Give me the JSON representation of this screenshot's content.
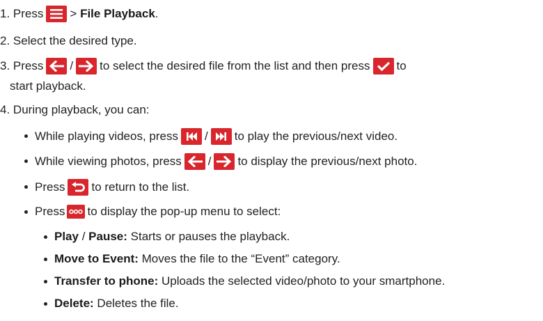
{
  "step1": {
    "num": "1.",
    "press": "Press",
    "sep": ">",
    "item": "File Playback",
    "end": "."
  },
  "step2": {
    "num": "2.",
    "text": "Select the desired type."
  },
  "step3": {
    "num": "3.",
    "press": "Press",
    "slash": "/",
    "mid": "to select the desired file from the list and then press",
    "tail": "to",
    "cont": "start playback."
  },
  "step4": {
    "num": "4.",
    "text": "During playback, you can:"
  },
  "b1": {
    "a": "While playing videos, press",
    "slash": "/",
    "b": "to play the previous/next video."
  },
  "b2": {
    "a": "While viewing photos, press",
    "slash": "/",
    "b": "to display the previous/next photo."
  },
  "b3": {
    "a": "Press",
    "b": "to return to the list."
  },
  "b4": {
    "a": "Press",
    "b": "to display the pop-up menu to select:"
  },
  "menu": [
    {
      "bold1": "Play",
      "slash": " / ",
      "bold2": "Pause:",
      "text": " Starts or pauses the playback."
    },
    {
      "bold1": "Move to Event:",
      "text": " Moves the file to the “Event” category."
    },
    {
      "bold1": "Transfer to phone:",
      "text": " Uploads the selected video/photo to your smartphone."
    },
    {
      "bold1": "Delete:",
      "text": " Deletes the file."
    }
  ],
  "icons": {
    "menu": "menu-icon",
    "left": "arrow-left-icon",
    "right": "arrow-right-icon",
    "ok": "checkmark-icon",
    "prev": "skip-previous-icon",
    "next": "skip-next-icon",
    "back": "return-icon",
    "more": "more-options-icon"
  },
  "colors": {
    "icon_bg": "#d8262c",
    "text": "#222222"
  }
}
